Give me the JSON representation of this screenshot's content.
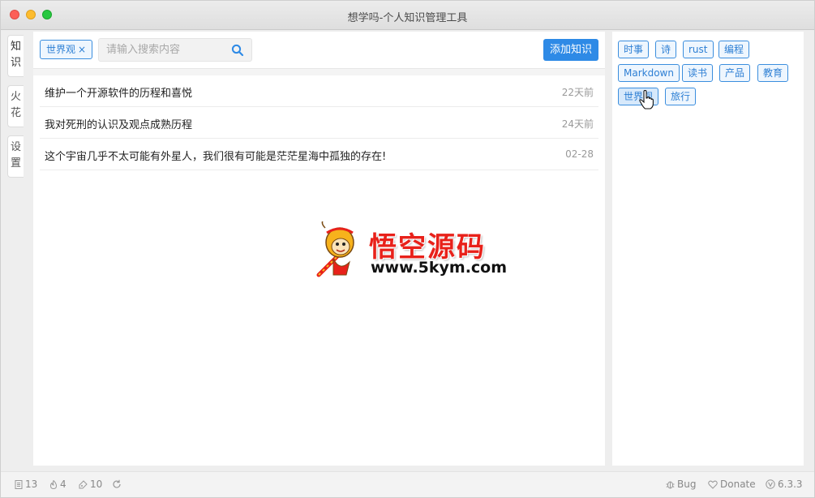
{
  "window": {
    "title": "想学吗-个人知识管理工具"
  },
  "sidebar": {
    "tabs": [
      {
        "chars": [
          "知",
          "识"
        ]
      },
      {
        "chars": [
          "火",
          "花"
        ]
      },
      {
        "chars": [
          "设",
          "置"
        ]
      }
    ]
  },
  "toolbar": {
    "active_filter": "世界观",
    "filter_remove": "×",
    "search_placeholder": "请输入搜索内容",
    "add_label": "添加知识"
  },
  "list": [
    {
      "title": "维护一个开源软件的历程和喜悦",
      "date": "22天前"
    },
    {
      "title": "我对死刑的认识及观点成熟历程",
      "date": "24天前"
    },
    {
      "title": "这个宇宙几乎不太可能有外星人，我们很有可能是茫茫星海中孤独的存在!",
      "date": "02-28"
    }
  ],
  "tags": [
    "时事",
    "诗",
    "rust",
    "编程",
    "Markdown",
    "读书",
    "产品",
    "教育",
    "世界观",
    "旅行"
  ],
  "watermark": {
    "name": "悟空源码",
    "url": "www.5kym.com"
  },
  "status": {
    "doc_count": "13",
    "spark_count": "4",
    "tag_count": "10",
    "bug_label": "Bug",
    "donate_label": "Donate",
    "version": "6.3.3"
  },
  "colors": {
    "accent": "#2e8ae6",
    "tag_border": "#3b8ede",
    "watermark_red": "#e8211a"
  },
  "icons": {
    "search": "search-icon",
    "doc": "document-icon",
    "spark": "fire-icon",
    "tag": "tag-icon",
    "sync": "sync-icon",
    "bug": "bug-icon",
    "donate": "heart-icon",
    "version": "version-icon"
  }
}
